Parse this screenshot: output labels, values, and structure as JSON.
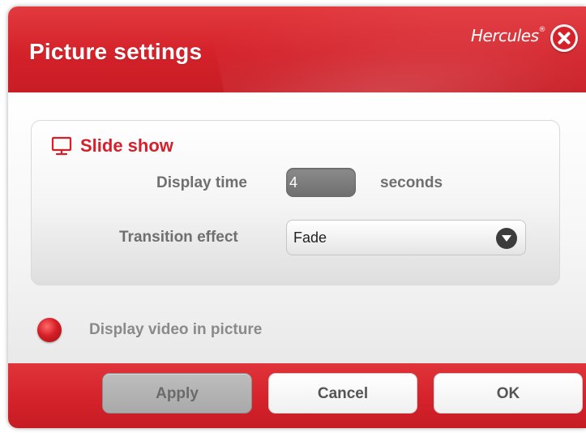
{
  "window": {
    "title": "Picture settings",
    "brand": "Hercules",
    "brand_mark": "®"
  },
  "slideshow": {
    "section_title": "Slide show",
    "display_time_label": "Display time",
    "display_time_value": "4",
    "display_time_unit": "seconds",
    "transition_label": "Transition effect",
    "transition_value": "Fade"
  },
  "options": {
    "video_in_picture_label": "Display video in picture",
    "video_in_picture_selected": true
  },
  "buttons": {
    "apply": "Apply",
    "cancel": "Cancel",
    "ok": "OK"
  },
  "colors": {
    "accent": "#d4212a",
    "section_title": "#d71f2b",
    "label_gray": "#6f6f6f"
  },
  "icons": {
    "close": "close-icon",
    "section": "monitor-icon",
    "dropdown": "chevron-down-icon"
  }
}
